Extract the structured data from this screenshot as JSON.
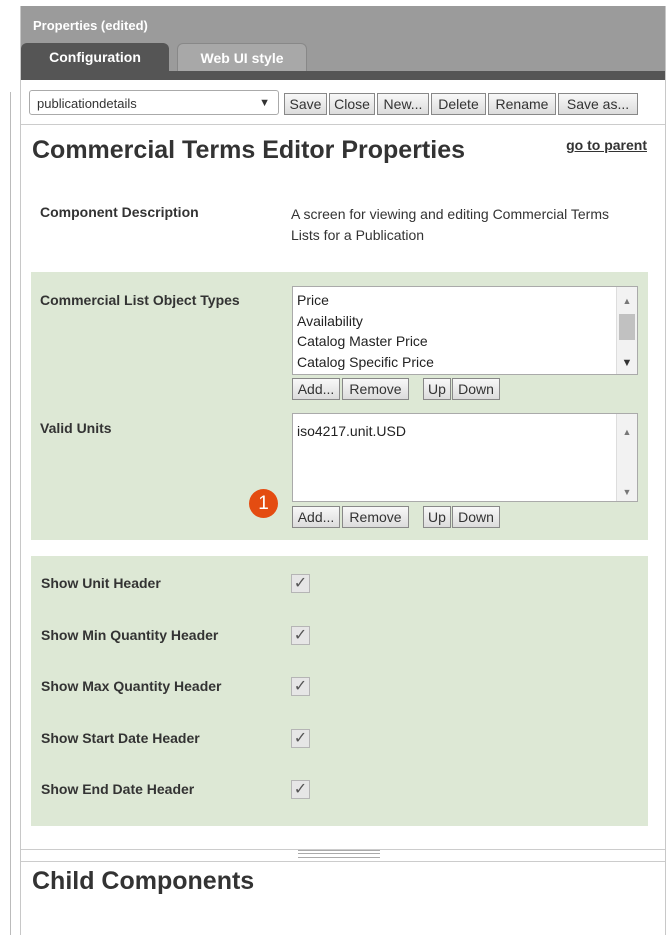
{
  "panel": {
    "title": "Properties (edited)",
    "tabs": [
      {
        "label": "Configuration",
        "active": true
      },
      {
        "label": "Web UI style",
        "active": false
      }
    ]
  },
  "toolbar": {
    "select_value": "publicationdetails",
    "dropdown_arrow": "▼",
    "buttons": [
      "Save",
      "Close",
      "New...",
      "Delete",
      "Rename",
      "Save as..."
    ]
  },
  "main": {
    "heading": "Commercial Terms Editor Properties",
    "parent_link": "go to parent",
    "component_description_label": "Component Description",
    "component_description": "A screen for viewing and editing Commercial Terms Lists for a Publication",
    "object_types_label": "Commercial List Object Types",
    "object_types": [
      "Price",
      "Availability",
      "Catalog Master Price",
      "Catalog Specific Price"
    ],
    "valid_units_label": "Valid Units",
    "valid_units": [
      "iso4217.unit.USD"
    ],
    "list_buttons": {
      "add": "Add...",
      "remove": "Remove",
      "up": "Up",
      "down": "Down"
    },
    "badge": "1",
    "checkboxes": [
      {
        "label": "Show Unit Header",
        "checked": true
      },
      {
        "label": "Show Min Quantity Header",
        "checked": true
      },
      {
        "label": "Show Max Quantity Header",
        "checked": true
      },
      {
        "label": "Show Start Date Header",
        "checked": true
      },
      {
        "label": "Show End Date Header",
        "checked": true
      }
    ],
    "check_glyph": "✓",
    "child_heading": "Child Components"
  },
  "colors": {
    "accent_green": "#dde8d5",
    "badge": "#e44c11",
    "tab_active": "#555555"
  }
}
